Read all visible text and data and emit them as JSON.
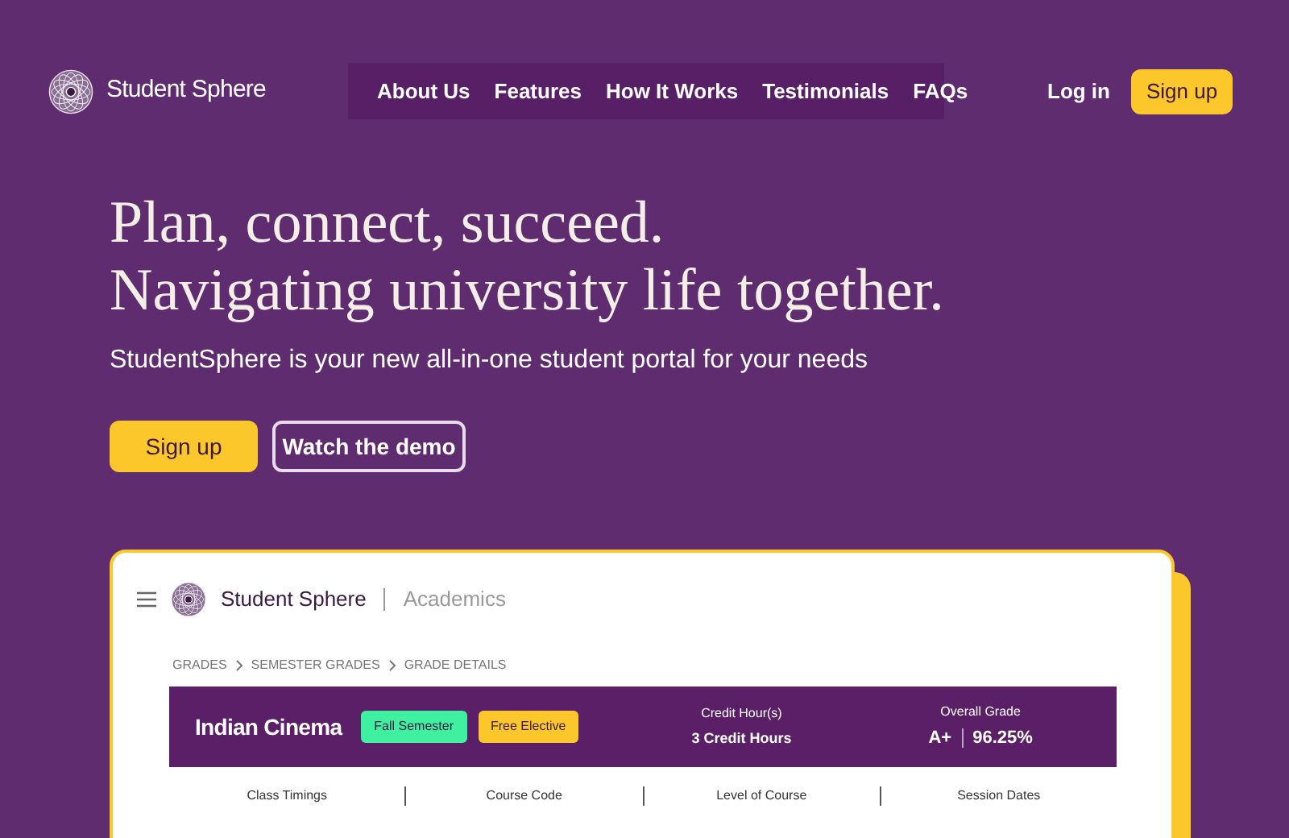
{
  "brand": "Student Sphere",
  "nav": [
    "About Us",
    "Features",
    "How It Works",
    "Testimonials",
    "FAQs"
  ],
  "login": "Log in",
  "signup": "Sign up",
  "hero": {
    "line1": "Plan, connect, succeed.",
    "line2": "Navigating university life together.",
    "subtitle": "StudentSphere is your new all-in-one student portal for your needs",
    "primary": "Sign up",
    "secondary": "Watch the demo"
  },
  "preview": {
    "brand": "Student Sphere",
    "section": "Academics",
    "breadcrumb": [
      "GRADES",
      "SEMESTER GRADES",
      "GRADE DETAILS"
    ],
    "course": "Indian Cinema",
    "tags": [
      {
        "label": "Fall Semester",
        "color": "#3ef0a0"
      },
      {
        "label": "Free Elective",
        "color": "#fcc72b"
      }
    ],
    "credit_label": "Credit Hour(s)",
    "credit_value": "3 Credit Hours",
    "grade_label": "Overall Grade",
    "grade_letter": "A+",
    "grade_percent": "96.25%",
    "columns": [
      "Class Timings",
      "Course Code",
      "Level of Course",
      "Session Dates"
    ]
  }
}
